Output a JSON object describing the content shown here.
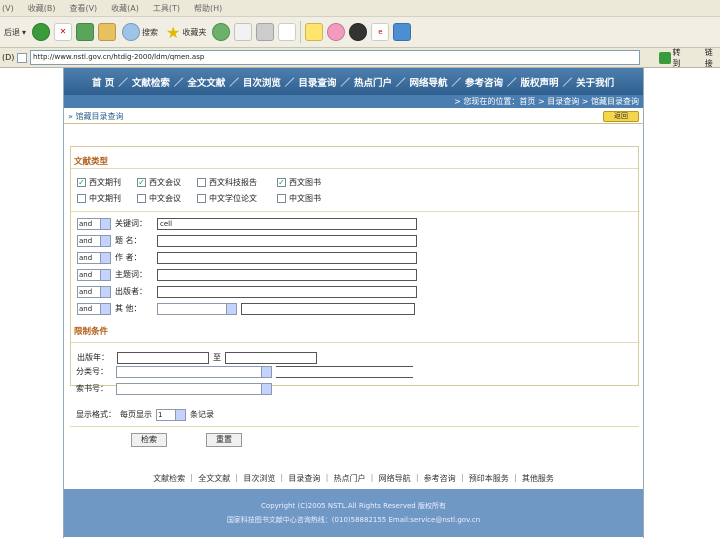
{
  "browser": {
    "menu": [
      "(V)",
      "收藏(B)",
      "查看(V)",
      "收藏(A)",
      "工具(T)",
      "帮助(H)"
    ],
    "toolbar": {
      "back": "后退",
      "search": "搜索",
      "favorites": "收藏夹"
    },
    "address": {
      "label": "(D)",
      "url": "http://www.nstl.gov.cn/htdig-2000/ldm/qmen.asp",
      "go": "转到",
      "links": "链接"
    }
  },
  "site": {
    "nav": [
      "首 页",
      "文献检索",
      "全文文献",
      "目次浏览",
      "目录查询",
      "热点门户",
      "网络导航",
      "参考咨询",
      "版权声明",
      "关于我们"
    ],
    "breadcrumb": "> 您现在的位置：首页 > 目录查询 > 馆藏目录查询",
    "page_title": "馆藏目录查询",
    "return_label": "返回"
  },
  "doc_type": {
    "title": "文献类型",
    "options": [
      {
        "label": "西文期刊",
        "checked": true
      },
      {
        "label": "西文会议",
        "checked": true
      },
      {
        "label": "西文科技报告",
        "checked": false
      },
      {
        "label": "西文图书",
        "checked": true
      },
      {
        "label": "中文期刊",
        "checked": false
      },
      {
        "label": "中文会议",
        "checked": false
      },
      {
        "label": "中文学位论文",
        "checked": false
      },
      {
        "label": "中文图书",
        "checked": false
      }
    ]
  },
  "search_rows": [
    {
      "op": "and",
      "label": "关键词：",
      "value": "cell"
    },
    {
      "op": "and",
      "label": "题 名：",
      "value": ""
    },
    {
      "op": "and",
      "label": "作 者：",
      "value": ""
    },
    {
      "op": "and",
      "label": "主题词：",
      "value": ""
    },
    {
      "op": "and",
      "label": "出版者：",
      "value": ""
    },
    {
      "op": "and",
      "label": "其 他：",
      "value": ""
    }
  ],
  "limits": {
    "title": "限制条件",
    "year_label": "出版年：",
    "year_to": "至",
    "class_label": "分类号：",
    "call_label": "索书号：",
    "display_label": "显示格式：",
    "per_page_label": "每页显示",
    "per_page_value": "1",
    "records_label": "条记录",
    "search_button": "检索",
    "reset_button": "重置"
  },
  "footer": {
    "links": "文献检索 ｜ 全文文献 ｜ 目次浏览 ｜ 目录查询 ｜ 热点门户 ｜ 网络导航 ｜ 参考咨询 ｜ 预印本服务 ｜ 其他服务",
    "copyright": "Copyright (C)2005 NSTL.All Rights Reserved 版权所有",
    "contact": "国家科技图书文献中心咨询热线：(010)58882155 Email:service@nstl.gov.cn"
  }
}
